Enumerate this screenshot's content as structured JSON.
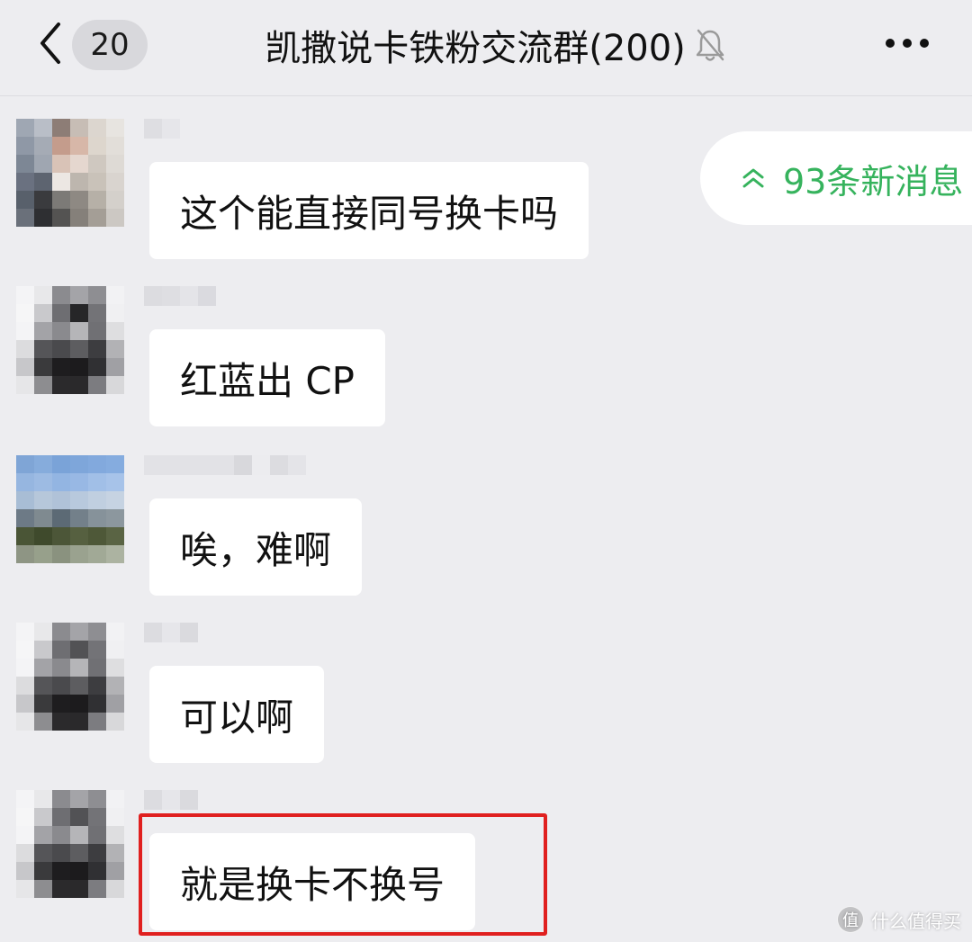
{
  "nav": {
    "unread_count": "20",
    "title": "凯撒说卡铁粉交流群(200)",
    "back_icon": "chevron-left-icon",
    "mute_icon": "bell-off-icon",
    "more_icon": "more-horizontal-icon"
  },
  "new_messages": {
    "label": "93条新消息",
    "icon": "double-chevron-up-icon",
    "color": "#36b35d"
  },
  "messages": [
    {
      "text": "这个能直接同号换卡吗"
    },
    {
      "text": "红蓝出 CP"
    },
    {
      "text": "唉，难啊"
    },
    {
      "text": "可以啊"
    },
    {
      "text": "就是换卡不换号"
    }
  ],
  "highlight_color": "#e0201f",
  "watermark": {
    "badge": "值",
    "text": "什么值得买"
  }
}
